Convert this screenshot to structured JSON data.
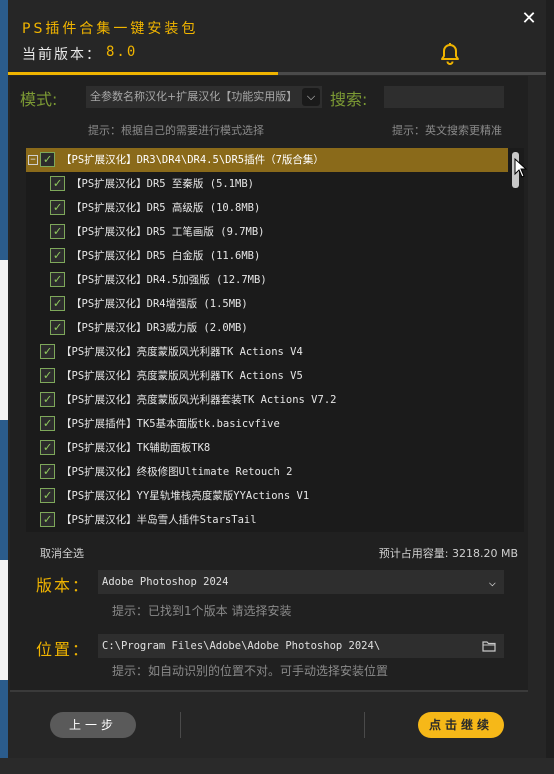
{
  "window": {
    "title": "PS插件合集一键安装包",
    "version_label": "当前版本：",
    "version_value": "8.0",
    "close_glyph": "✕"
  },
  "filters": {
    "mode_label": "模式:",
    "mode_value": "全参数名称汉化+扩展汉化【功能实用版】",
    "mode_hint": "提示：根据自己的需要进行模式选择",
    "search_label": "搜索:",
    "search_value": "",
    "search_hint": "提示：英文搜索更精准"
  },
  "plugin_list": {
    "items": [
      {
        "label": "【PS扩展汉化】DR3\\DR4\\DR4.5\\DR5插件（7版合集）",
        "level": 0,
        "expanded": true,
        "checked": true,
        "highlighted": true
      },
      {
        "label": "【PS扩展汉化】DR5 至秦版 (5.1MB)",
        "level": 1,
        "checked": true
      },
      {
        "label": "【PS扩展汉化】DR5 高级版 (10.8MB)",
        "level": 1,
        "checked": true
      },
      {
        "label": "【PS扩展汉化】DR5 工笔画版 (9.7MB)",
        "level": 1,
        "checked": true
      },
      {
        "label": "【PS扩展汉化】DR5 白金版 (11.6MB)",
        "level": 1,
        "checked": true
      },
      {
        "label": "【PS扩展汉化】DR4.5加强版 (12.7MB)",
        "level": 1,
        "checked": true
      },
      {
        "label": "【PS扩展汉化】DR4增强版 (1.5MB)",
        "level": 1,
        "checked": true
      },
      {
        "label": "【PS扩展汉化】DR3威力版 (2.0MB)",
        "level": 1,
        "checked": true
      },
      {
        "label": "【PS扩展汉化】亮度蒙版风光利器TK Actions V4",
        "level": 0,
        "checked": true
      },
      {
        "label": "【PS扩展汉化】亮度蒙版风光利器TK Actions V5",
        "level": 0,
        "checked": true
      },
      {
        "label": "【PS扩展汉化】亮度蒙版风光利器套装TK Actions V7.2",
        "level": 0,
        "checked": true
      },
      {
        "label": "【PS扩展插件】TK5基本面版tk.basicvfive",
        "level": 0,
        "checked": true
      },
      {
        "label": "【PS扩展汉化】TK辅助面板TK8",
        "level": 0,
        "checked": true
      },
      {
        "label": "【PS扩展汉化】终极修图Ultimate Retouch 2",
        "level": 0,
        "checked": true
      },
      {
        "label": "【PS扩展汉化】YY星轨堆栈亮度蒙版YYActions V1",
        "level": 0,
        "checked": true
      },
      {
        "label": "【PS扩展汉化】半岛雪人插件StarsTail",
        "level": 0,
        "checked": true
      }
    ],
    "deselect_all": "取消全选",
    "disk_usage": "预计占用容量: 3218.20 MB"
  },
  "install": {
    "ps_label": "版本：",
    "ps_value": "Adobe Photoshop 2024",
    "ps_hint": "提示：已找到1个版本 请选择安装",
    "location_label": "位置：",
    "location_value": "C:\\Program Files\\Adobe\\Adobe Photoshop 2024\\",
    "location_hint": "提示：如自动识别的位置不对。可手动选择安装位置"
  },
  "footer": {
    "prev_label": "上一步",
    "next_label": "点击继续"
  },
  "colors": {
    "accent": "#f0b400",
    "green_label": "#7c9a34",
    "highlight_row": "#8a6a1a",
    "check_green": "#8fc85e"
  },
  "icons": {
    "bell": "bell-icon",
    "chevron": "chevron-down-icon",
    "folder": "folder-icon",
    "checkbox": "checkbox-checked-icon",
    "collapse": "collapse-minus-icon"
  }
}
